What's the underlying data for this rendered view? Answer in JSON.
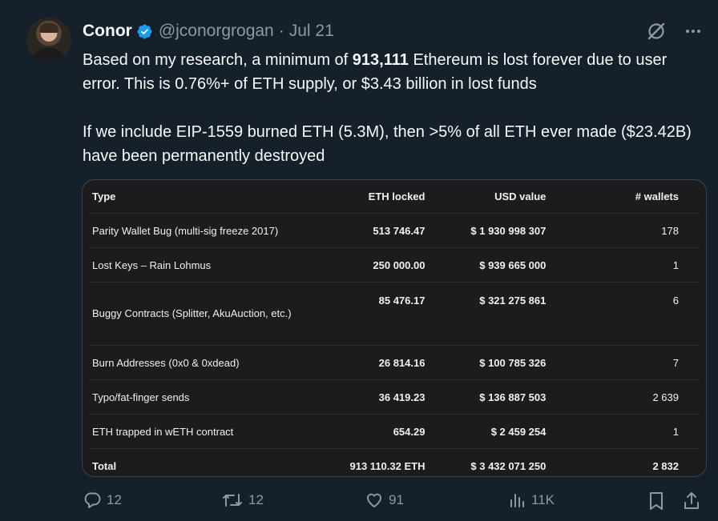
{
  "tweet": {
    "author_name": "Conor",
    "handle": "@jconorgrogan",
    "separator": "·",
    "date": "Jul 21",
    "line1_pre": "Based on my research, a minimum of ",
    "line1_bold": "913,111",
    "line1_post": " Ethereum is lost forever due to user error.  This is 0.76%+ of ETH supply, or $3.43 billion in lost funds",
    "para2": "If we include EIP-1559 burned ETH (5.3M), then >5% of all ETH ever made ($23.42B) have been permanently destroyed"
  },
  "table": {
    "headers": {
      "type": "Type",
      "eth": "ETH locked",
      "usd": "USD value",
      "wallets": "# wallets"
    },
    "rows": [
      {
        "type": "Parity Wallet Bug (multi-sig freeze 2017)",
        "eth": "513 746.47",
        "usd": "$ 1 930 998 307",
        "wallets": "178"
      },
      {
        "type": "Lost Keys – Rain Lohmus",
        "eth": "250 000.00",
        "usd": "$ 939 665 000",
        "wallets": "1"
      },
      {
        "type": "Buggy Contracts (Splitter, AkuAuction, etc.)",
        "eth": "85 476.17",
        "usd": "$ 321 275 861",
        "wallets": "6"
      },
      {
        "type": "Burn Addresses (0x0 & 0xdead)",
        "eth": "26 814.16",
        "usd": "$ 100 785 326",
        "wallets": "7"
      },
      {
        "type": "Typo/fat-finger sends",
        "eth": "36 419.23",
        "usd": "$ 136 887 503",
        "wallets": "2 639"
      },
      {
        "type": "ETH trapped in wETH contract",
        "eth": "654.29",
        "usd": "$ 2 459 254",
        "wallets": "1"
      },
      {
        "type": "Total",
        "eth": "913 110.32 ETH",
        "usd": "$ 3 432 071 250",
        "wallets": "2 832"
      }
    ]
  },
  "actions": {
    "replies": "12",
    "retweets": "12",
    "likes": "91",
    "views": "11K"
  },
  "icons": {
    "verified": "verified-badge-icon",
    "grok": "grok-icon",
    "more": "more-icon",
    "reply": "reply-icon",
    "retweet": "retweet-icon",
    "like": "like-icon",
    "views": "views-icon",
    "bookmark": "bookmark-icon",
    "share": "share-icon"
  },
  "colors": {
    "background": "#15202b",
    "verified": "#1d9bf0",
    "muted": "#8b98a5",
    "card": "#1c1c1e"
  }
}
